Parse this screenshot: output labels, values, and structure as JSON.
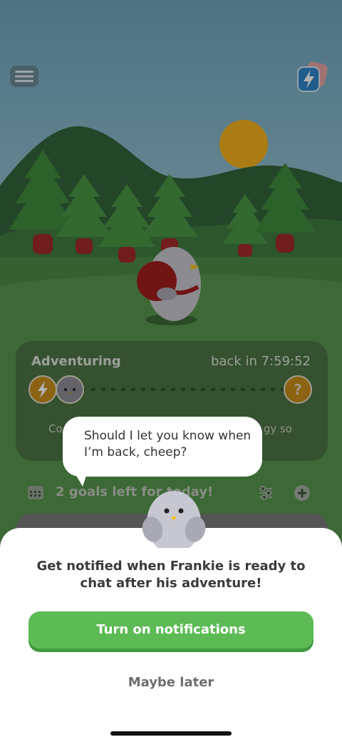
{
  "adventure": {
    "title": "Adventuring",
    "timer": "back in 7:59:52",
    "text_left": "Co",
    "text_right": "gy so",
    "question_mark": "?"
  },
  "goals": {
    "text": "2 goals left for today!"
  },
  "bubble": {
    "text": "Should I let you know when I’m back, cheep?"
  },
  "sheet": {
    "message": "Get notified when Frankie is ready to chat after his adventure!",
    "primary_button": "Turn on notifications",
    "secondary_button": "Maybe later"
  },
  "icons": {
    "menu": "hamburger-menu-icon",
    "energy": "lightning-bolt-icon",
    "calendar": "calendar-icon",
    "filter": "sliders-icon",
    "add": "plus-circle-icon"
  },
  "colors": {
    "primary_green": "#5cbb55",
    "sky": "#7fb5c7",
    "energy_orange": "#f2b11a",
    "energy_blue": "#2e84c9"
  }
}
